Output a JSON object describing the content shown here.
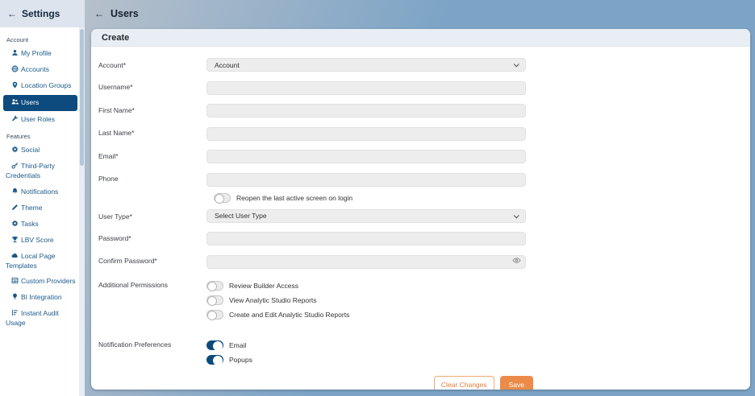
{
  "colors": {
    "accent_navy": "#0d4a7d",
    "accent_orange": "#ec8b49",
    "link_blue": "#1c5a8a",
    "main_background": "#7da4c6"
  },
  "sidebar": {
    "back_arrow": "←",
    "title": "Settings",
    "sections": [
      {
        "label": "Account",
        "items": [
          {
            "label": "My Profile",
            "icon": "person-icon",
            "selected": false
          },
          {
            "label": "Accounts",
            "icon": "globe-icon",
            "selected": false
          },
          {
            "label": "Location Groups",
            "icon": "map-pin-icon",
            "selected": false
          },
          {
            "label": "Users",
            "icon": "users-icon",
            "selected": true
          },
          {
            "label": "User Roles",
            "icon": "wrench-icon",
            "selected": false
          }
        ]
      },
      {
        "label": "Features",
        "items": [
          {
            "label": "Social",
            "icon": "gear-icon",
            "selected": false
          },
          {
            "label": "Third-Party Credentials",
            "icon": "key-icon",
            "selected": false
          },
          {
            "label": "Notifications",
            "icon": "bell-icon",
            "selected": false
          },
          {
            "label": "Theme",
            "icon": "pencil-icon",
            "selected": false
          },
          {
            "label": "Tasks",
            "icon": "gear-icon",
            "selected": false
          },
          {
            "label": "LBV Score",
            "icon": "trophy-icon",
            "selected": false
          },
          {
            "label": "Local Page Templates",
            "icon": "cloud-icon",
            "selected": false
          },
          {
            "label": "Custom Providers",
            "icon": "table-icon",
            "selected": false
          },
          {
            "label": "BI Integration",
            "icon": "bulb-icon",
            "selected": false
          },
          {
            "label": "Instant Audit Usage",
            "icon": "audit-chart-icon",
            "selected": false
          }
        ]
      }
    ]
  },
  "main": {
    "back_arrow": "←",
    "title": "Users",
    "card": {
      "title": "Create",
      "fields": {
        "account": {
          "label": "Account*",
          "value": "Account",
          "type": "select"
        },
        "username": {
          "label": "Username*",
          "value": ""
        },
        "first_name": {
          "label": "First Name*",
          "value": ""
        },
        "last_name": {
          "label": "Last Name*",
          "value": ""
        },
        "email": {
          "label": "Email*",
          "value": ""
        },
        "phone": {
          "label": "Phone",
          "value": ""
        },
        "reopen_login": {
          "label": "Reopen the last active screen on login",
          "on": false
        },
        "user_type": {
          "label": "User Type*",
          "value": "Select User Type",
          "type": "select"
        },
        "password": {
          "label": "Password*",
          "value": ""
        },
        "confirm_password": {
          "label": "Confirm Password*",
          "value": ""
        }
      },
      "additional_permissions": {
        "label": "Additional Permissions",
        "toggles": [
          {
            "label": "Review Builder Access",
            "on": false
          },
          {
            "label": "View Analytic Studio Reports",
            "on": false
          },
          {
            "label": "Create and Edit Analytic Studio Reports",
            "on": false
          }
        ]
      },
      "notification_preferences": {
        "label": "Notification Preferences",
        "toggles": [
          {
            "label": "Email",
            "on": true
          },
          {
            "label": "Popups",
            "on": true
          }
        ]
      },
      "buttons": {
        "clear": "Clear Changes",
        "save": "Save"
      }
    }
  }
}
